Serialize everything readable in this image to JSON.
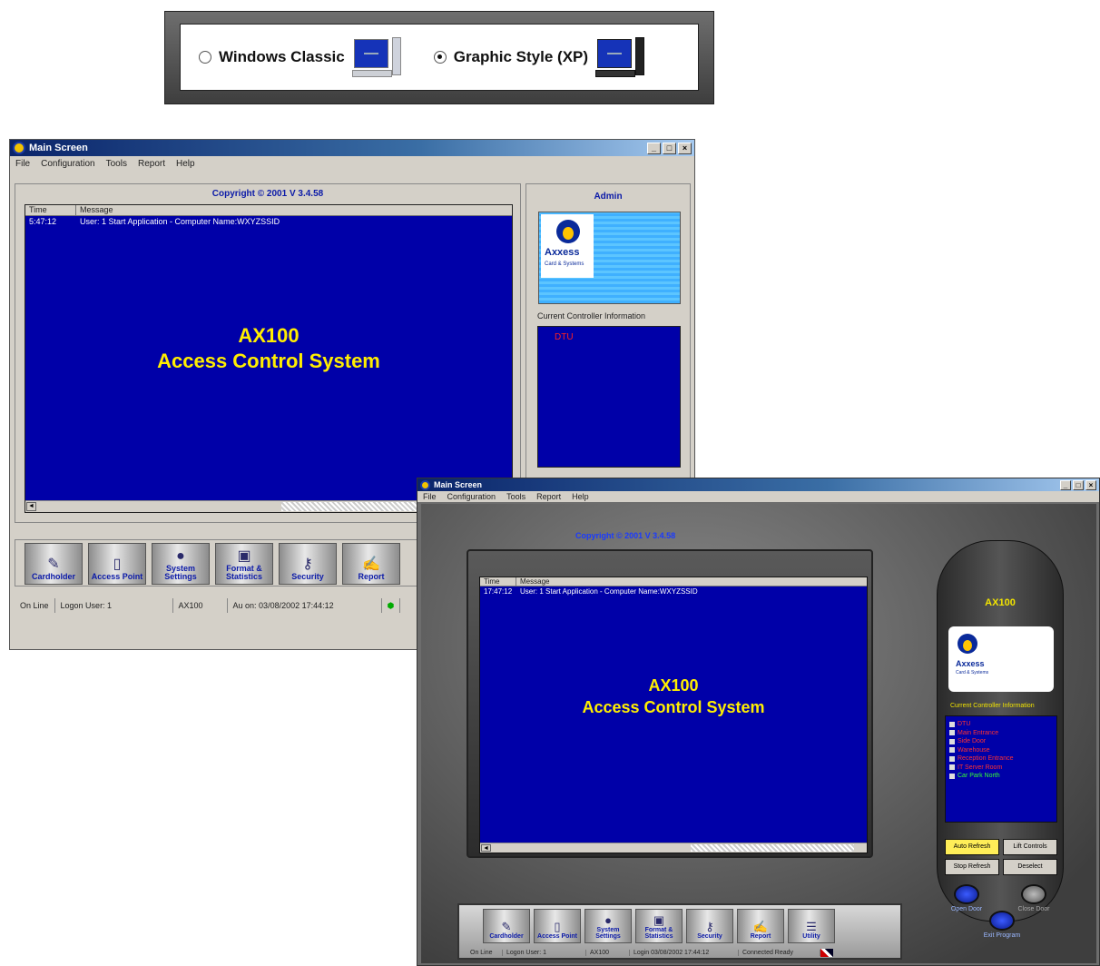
{
  "selector": {
    "option1": "Windows Classic",
    "option2": "Graphic Style (XP)",
    "selected": "option2"
  },
  "classic": {
    "title": "Main Screen",
    "menu": [
      "File",
      "Configuration",
      "Tools",
      "Report",
      "Help"
    ],
    "copyright": "Copyright © 2001 V 3.4.58",
    "log_headers": [
      "Time",
      "Message"
    ],
    "log_rows": [
      {
        "time": "5:47:12",
        "message": "User: 1 Start Application - Computer Name:WXYZSSID"
      }
    ],
    "main_title_line1": "AX100",
    "main_title_line2": "Access Control System",
    "admin_label": "Admin",
    "logo_word": "Axxess",
    "logo_sub": "Card & Systems",
    "controller_label": "Current Controller Information",
    "controller_items": [
      "DTU"
    ],
    "toolbar": [
      "Cardholder",
      "Access Point",
      "System Settings",
      "Format & Statistics",
      "Security",
      "Report"
    ],
    "status": [
      "On Line",
      "Logon User: 1",
      "AX100",
      "Au on: 03/08/2002 17:44:12"
    ]
  },
  "xp": {
    "title": "Main Screen",
    "menu": [
      "File",
      "Configuration",
      "Tools",
      "Report",
      "Help"
    ],
    "copyright": "Copyright © 2001 V 3.4.58",
    "log_headers": [
      "Time",
      "Message"
    ],
    "log_rows": [
      {
        "time": "17:47:12",
        "message": "User: 1 Start Application - Computer Name:WXYZSSID"
      }
    ],
    "main_title_line1": "AX100",
    "main_title_line2": "Access Control System",
    "side_title": "AX100",
    "logo_word": "Axxess",
    "logo_sub": "Card & Systems",
    "controller_label": "Current Controller Information",
    "controller_items": [
      {
        "label": "DTU",
        "color": "#ff3030"
      },
      {
        "label": "Main Entrance",
        "color": "#ff3030"
      },
      {
        "label": "Side Door",
        "color": "#ff3030"
      },
      {
        "label": "Warehouse",
        "color": "#ff3030"
      },
      {
        "label": "Reception Entrance",
        "color": "#ff3030"
      },
      {
        "label": "IT Server Room",
        "color": "#ff3030"
      },
      {
        "label": "Car Park North",
        "color": "#33ff33"
      }
    ],
    "side_buttons": [
      "Auto Refresh",
      "Lift Controls",
      "Stop Refresh",
      "Deselect"
    ],
    "round_buttons": [
      "Open Door",
      "Close Door",
      "Exit Program"
    ],
    "toolbar": [
      "Cardholder",
      "Access Point",
      "System Settings",
      "Format & Statistics",
      "Security",
      "Report",
      "Utility"
    ],
    "status": [
      "On Line",
      "Logon User: 1",
      "AX100",
      "Login 03/08/2002 17:44:12",
      "Connected Ready"
    ]
  },
  "colors": {
    "screen_blue": "#0000a8",
    "title_yellow": "#ffee00",
    "link_blue": "#0b1aa8",
    "alarm_red": "#ff2020"
  }
}
